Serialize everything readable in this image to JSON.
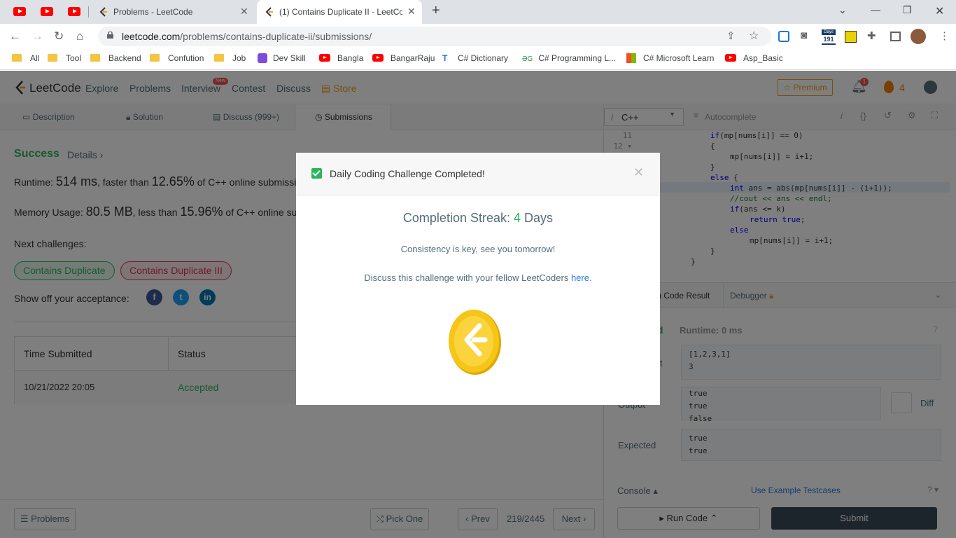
{
  "browser": {
    "tabs": [
      {
        "title": "Problems - LeetCode"
      },
      {
        "title": "(1) Contains Duplicate II - LeetCo"
      }
    ],
    "url_host": "leetcode.com",
    "url_path": "/problems/contains-duplicate-ii/submissions/",
    "ext_badge": "191",
    "bookmarks": [
      {
        "label": "All",
        "icon": "folder-icon"
      },
      {
        "label": "Tool",
        "icon": "folder-icon"
      },
      {
        "label": "Backend",
        "icon": "folder-icon"
      },
      {
        "label": "Confution",
        "icon": "folder-icon"
      },
      {
        "label": "Job",
        "icon": "folder-icon"
      },
      {
        "label": "Dev Skill",
        "icon": "devskill-icon"
      },
      {
        "label": "Bangla",
        "icon": "youtube-icon"
      },
      {
        "label": "BangarRaju",
        "icon": "youtube-icon"
      },
      {
        "label": "C# Dictionary",
        "icon": "tutorialsteacher-icon"
      },
      {
        "label": "C# Programming L...",
        "icon": "geeks-icon"
      },
      {
        "label": "C# Microsoft Learn",
        "icon": "microsoft-icon"
      },
      {
        "label": "Asp_Basic",
        "icon": "youtube-icon"
      }
    ]
  },
  "lc_nav": {
    "brand": "LeetCode",
    "links": [
      "Explore",
      "Problems",
      "Interview",
      "Contest",
      "Discuss",
      "Store"
    ],
    "new_badge": "New",
    "premium": "Premium",
    "notif_count": "1",
    "streak": "4"
  },
  "left": {
    "tabs": [
      "Description",
      "Solution",
      "Discuss (999+)",
      "Submissions"
    ],
    "status": "Success",
    "details": "Details",
    "runtime_label": "Runtime:",
    "runtime_value": "514 ms",
    "runtime_mid": ", faster than",
    "runtime_pct": "12.65%",
    "runtime_tail": "of C++ online submissions",
    "memory_label": "Memory Usage:",
    "memory_value": "80.5 MB",
    "memory_mid": ", less than",
    "memory_pct": "15.96%",
    "memory_tail": "of C++ online submissions",
    "next_label": "Next challenges:",
    "next": [
      "Contains Duplicate",
      "Contains Duplicate III"
    ],
    "share_label": "Show off your acceptance:",
    "table_headers": [
      "Time Submitted",
      "Status"
    ],
    "table_rows": [
      {
        "time": "10/21/2022 20:05",
        "status": "Accepted"
      }
    ]
  },
  "editor": {
    "language": "C++",
    "autocomplete": "Autocomplete",
    "line_numbers": [
      "11",
      "12"
    ],
    "result_tabs": [
      "Run Code Result",
      "Debugger"
    ],
    "result_status": "d",
    "result_runtime": "Runtime: 0 ms",
    "input_label": "t",
    "input": "[1,2,3,1]\n3",
    "output_label": "Output",
    "output": "true\ntrue\nfalse",
    "diff": "Diff",
    "expected_label": "Expected",
    "expected": "true\ntrue",
    "console": "Console",
    "use_example": "Use Example Testcases",
    "run_code": "Run Code",
    "submit": "Submit"
  },
  "bottom": {
    "problems": "Problems",
    "pick_one": "Pick One",
    "prev": "Prev",
    "page": "219/2445",
    "next": "Next"
  },
  "modal": {
    "title": "Daily Coding Challenge Completed!",
    "streak_label": "Completion Streak:",
    "streak_value": "4",
    "streak_unit": "Days",
    "message": "Consistency is key, see you tomorrow!",
    "discuss_text": "Discuss this challenge with your fellow LeetCoders",
    "discuss_link": "here."
  },
  "colors": {
    "success_green": "#2db55d",
    "accent_orange": "#f0a020",
    "link_blue": "#2a7ae2",
    "coin_gold": "#f5c518"
  }
}
